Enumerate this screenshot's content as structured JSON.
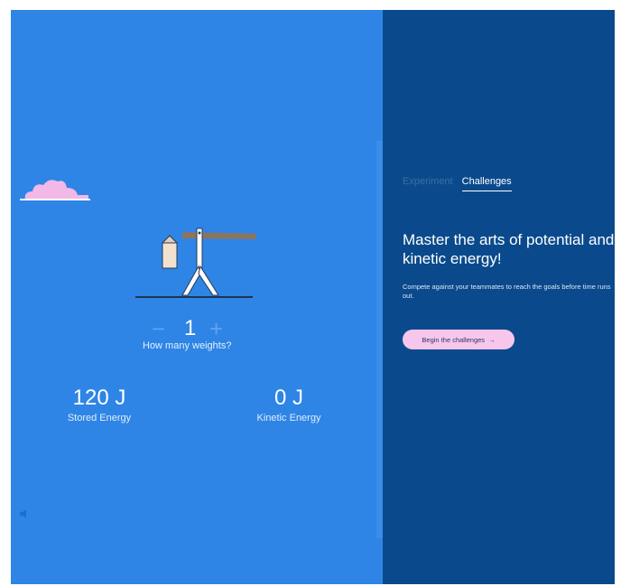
{
  "colors": {
    "left_panel": "#2e85e6",
    "right_panel": "#0a4a8c",
    "cloud": "#f2b8e8",
    "button_bg": "#f7c6ec"
  },
  "simulator": {
    "stepper": {
      "minus_symbol": "−",
      "plus_symbol": "+",
      "count": "1",
      "label": "How many weights?"
    },
    "stored_energy": {
      "value": "120 J",
      "label": "Stored Energy"
    },
    "kinetic_energy": {
      "value": "0 J",
      "label": "Kinetic Energy"
    }
  },
  "panel": {
    "tabs": [
      {
        "label": "Experiment",
        "active": false
      },
      {
        "label": "Challenges",
        "active": true
      }
    ],
    "headline": "Master the arts of potential and kinetic energy!",
    "description": "Compete against your teammates to reach the goals before time runs out.",
    "begin_button": {
      "label": "Begin the challenges",
      "arrow": "→"
    }
  },
  "icons": [
    "cloud-icon",
    "moon-icon",
    "catapult-illustration",
    "speaker-icon",
    "arrow-right-icon"
  ]
}
